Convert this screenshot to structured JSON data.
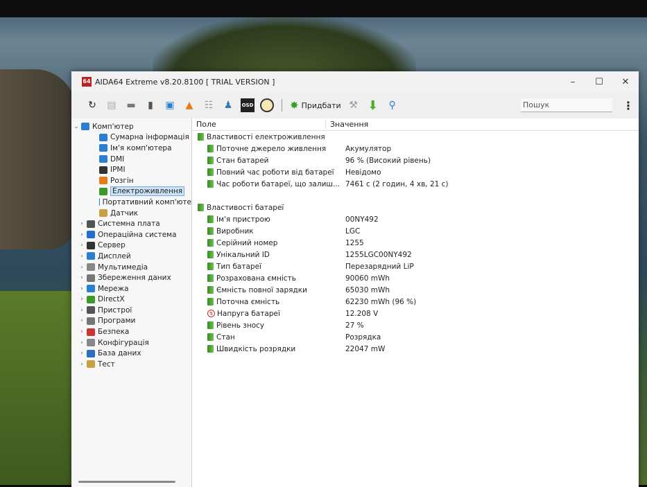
{
  "window": {
    "title": "AIDA64 Extreme v8.20.8100  [ TRIAL VERSION ]",
    "logo": "64"
  },
  "toolbar": {
    "buy_label": "Придбати",
    "search_placeholder": "Пошук",
    "icons": [
      "refresh-icon",
      "report-icon",
      "motherboard-icon",
      "memory-icon",
      "network-icon",
      "flame-icon",
      "config-icon",
      "user-icon",
      "osd-icon",
      "gauge-icon",
      "buy-icon",
      "tools-icon",
      "download-icon",
      "search-icon"
    ]
  },
  "tree": {
    "root": "Комп'ютер",
    "children": [
      "Сумарна інформація",
      "Ім'я комп'ютера",
      "DMI",
      "IPMI",
      "Розгін",
      "Електроживлення",
      "Портативний комп'юте",
      "Датчик"
    ],
    "sections": [
      "Системна плата",
      "Операційна система",
      "Сервер",
      "Дисплей",
      "Мультимедіа",
      "Збереження даних",
      "Мережа",
      "DirectX",
      "Пристрої",
      "Програми",
      "Безпека",
      "Конфігурація",
      "База даних",
      "Тест"
    ]
  },
  "list": {
    "headers": [
      "Поле",
      "Значення"
    ],
    "group1": "Властивості електроживлення",
    "rows1": [
      [
        "Поточне джерело живлення",
        "Акумулятор"
      ],
      [
        "Стан батарей",
        "96 % (Високий рівень)"
      ],
      [
        "Повний час роботи від батареї",
        "Невідомо"
      ],
      [
        "Час роботи батареї, що залиш...",
        "7461 с (2 годин, 4 хв, 21 с)"
      ]
    ],
    "group2": "Властивості батареї",
    "rows2": [
      [
        "Ім'я пристрою",
        "00NY492"
      ],
      [
        "Виробник",
        "LGC"
      ],
      [
        "Серійний номер",
        "1255"
      ],
      [
        "Унікальний ID",
        "1255LGC00NY492"
      ],
      [
        "Тип батареї",
        "Перезарядний LiP"
      ],
      [
        "Розрахована ємність",
        "90060 mWh"
      ],
      [
        "Ємність повної зарядки",
        "65030 mWh"
      ],
      [
        "Поточна ємність",
        "62230 mWh  (96 %)"
      ],
      [
        "Напруга батареї",
        "12.208 V"
      ],
      [
        "Рівень зносу",
        "27 %"
      ],
      [
        "Стан",
        "Розрядка"
      ],
      [
        "Швидкість розрядки",
        "22047 mW"
      ]
    ]
  }
}
